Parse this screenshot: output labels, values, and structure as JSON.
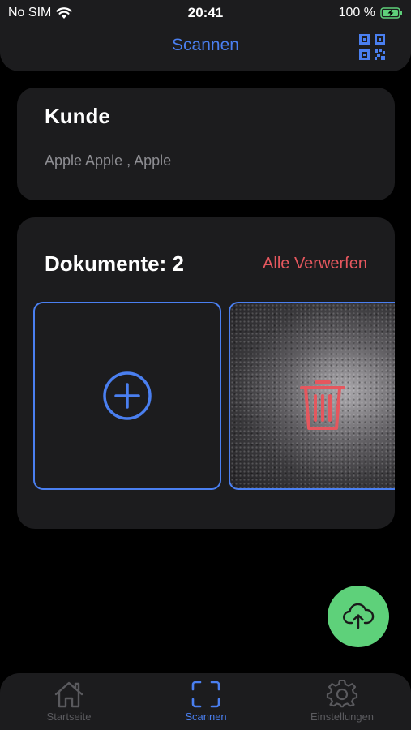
{
  "status_bar": {
    "carrier": "No SIM",
    "time": "20:41",
    "battery": "100 %"
  },
  "header": {
    "title": "Scannen",
    "qr_icon": "qr-code-icon"
  },
  "customer": {
    "title": "Kunde",
    "value": "Apple Apple , Apple"
  },
  "documents": {
    "title": "Dokumente: 2",
    "discard_all_label": "Alle Verwerfen",
    "add_icon": "plus-circle-icon",
    "delete_icon": "trash-icon"
  },
  "upload": {
    "icon": "cloud-upload-icon"
  },
  "tabs": [
    {
      "label": "Startseite",
      "icon": "home-icon"
    },
    {
      "label": "Scannen",
      "icon": "scan-icon"
    },
    {
      "label": "Einstellungen",
      "icon": "gear-icon"
    }
  ],
  "colors": {
    "accent": "#4a7ff0",
    "danger": "#e5575e",
    "success": "#5ed17a",
    "surface": "#1c1c1e",
    "background": "#000000"
  }
}
